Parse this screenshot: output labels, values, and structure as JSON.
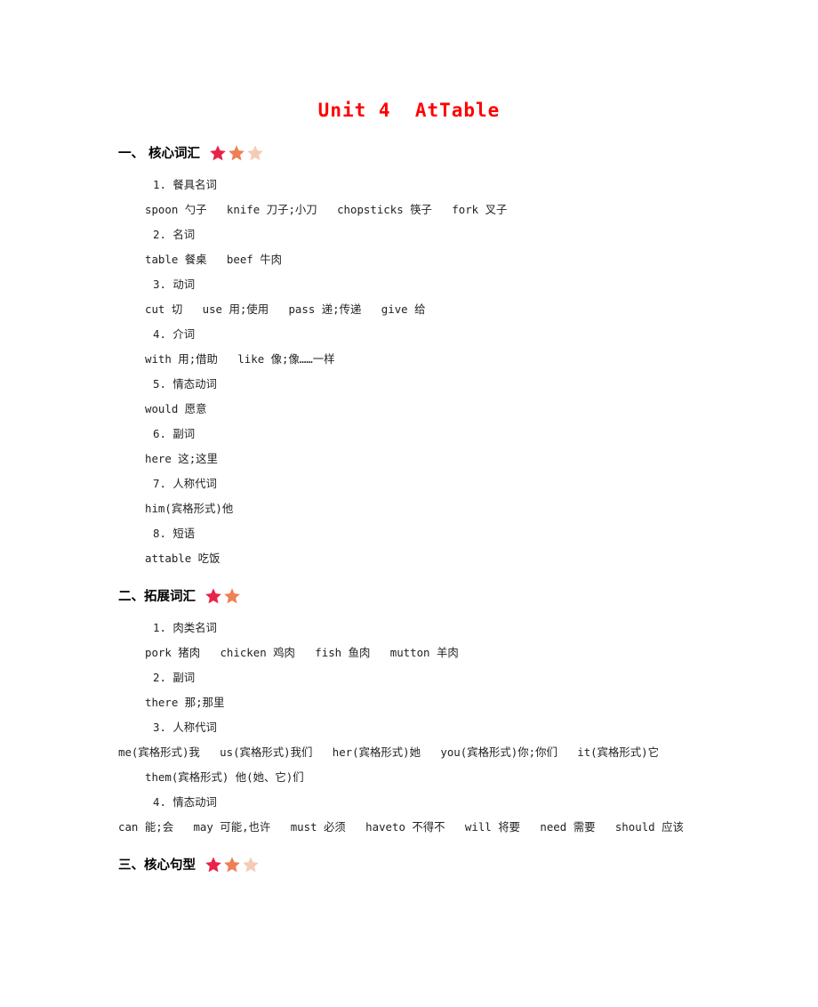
{
  "document": {
    "title": "Unit 4  AtTable",
    "title_color": "#ff0000"
  },
  "stars": {
    "colors": [
      "#e8234a",
      "#ee8055",
      "#f6cbb4"
    ]
  },
  "sections": [
    {
      "heading": "一、 核心词汇",
      "star_count": 3,
      "lines": [
        {
          "kind": "num",
          "text": "1. 餐具名词"
        },
        {
          "kind": "word",
          "text": "spoon 勺子   knife 刀子;小刀   chopsticks 筷子   fork 叉子"
        },
        {
          "kind": "num",
          "text": "2. 名词"
        },
        {
          "kind": "word",
          "text": "table 餐桌   beef 牛肉"
        },
        {
          "kind": "num",
          "text": "3. 动词"
        },
        {
          "kind": "word",
          "text": "cut 切   use 用;使用   pass 递;传递   give 给"
        },
        {
          "kind": "num",
          "text": "4. 介词"
        },
        {
          "kind": "word",
          "text": "with 用;借助   like 像;像……一样"
        },
        {
          "kind": "num",
          "text": "5. 情态动词"
        },
        {
          "kind": "word",
          "text": "would 愿意"
        },
        {
          "kind": "num",
          "text": "6. 副词"
        },
        {
          "kind": "word",
          "text": "here 这;这里"
        },
        {
          "kind": "num",
          "text": "7. 人称代词"
        },
        {
          "kind": "word",
          "text": "him(宾格形式)他"
        },
        {
          "kind": "num",
          "text": "8. 短语"
        },
        {
          "kind": "word",
          "text": "attable 吃饭"
        }
      ]
    },
    {
      "heading": "二、拓展词汇",
      "star_count": 2,
      "lines": [
        {
          "kind": "num",
          "text": "1. 肉类名词"
        },
        {
          "kind": "word",
          "text": "pork 猪肉   chicken 鸡肉   fish 鱼肉   mutton 羊肉"
        },
        {
          "kind": "num",
          "text": "2. 副词"
        },
        {
          "kind": "word",
          "text": "there 那;那里"
        },
        {
          "kind": "num",
          "text": "3. 人称代词"
        },
        {
          "kind": "wrap",
          "text": "me(宾格形式)我   us(宾格形式)我们   her(宾格形式)她   you(宾格形式)你;你们   it(宾格形式)它   them(宾格形式) 他(她、它)们"
        },
        {
          "kind": "num",
          "text": "4. 情态动词"
        },
        {
          "kind": "wrap",
          "text": "can 能;会   may 可能,也许   must 必须   haveto 不得不   will 将要   need 需要   should 应该"
        }
      ]
    },
    {
      "heading": "三、核心句型",
      "star_count": 3,
      "lines": []
    }
  ]
}
